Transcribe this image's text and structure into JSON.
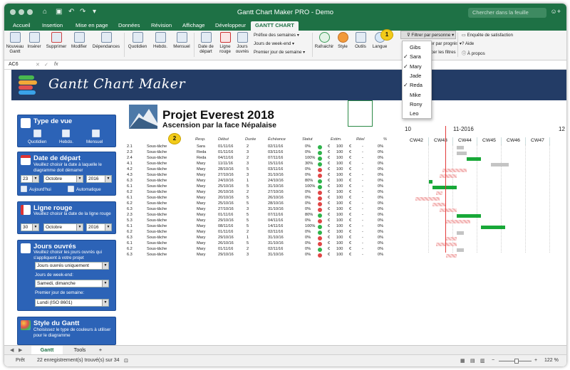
{
  "window": {
    "title": "Gantt Chart Maker PRO - Demo",
    "search_placeholder": "Chercher dans la feuille"
  },
  "menu_tabs": [
    "Accueil",
    "Insertion",
    "Mise en page",
    "Données",
    "Révision",
    "Affichage",
    "Développeur",
    "GANTT CHART"
  ],
  "ribbon": {
    "buttons": [
      {
        "label": "Nouveau\nGantt"
      },
      {
        "label": "Insérer"
      },
      {
        "label": "Supprimer"
      },
      {
        "label": "Modifier"
      },
      {
        "label": "Dépendances"
      },
      {
        "label": "Quotidien"
      },
      {
        "label": "Hebdo."
      },
      {
        "label": "Mensuel"
      },
      {
        "label": "Date de\ndépart"
      },
      {
        "label": "Ligne\nrouge"
      },
      {
        "label": "Jours\nouvrés"
      },
      {
        "label": "Rafraichir"
      },
      {
        "label": "Style"
      },
      {
        "label": "Outils"
      },
      {
        "label": "Langue"
      }
    ],
    "dropdowns": [
      "Préfixe des semaines",
      "Jours de week-end",
      "Premier jour de semaine"
    ],
    "filter_button": "Filtrer par personne",
    "filter_progress": "Filtrer par progrès",
    "clear_filters": "Effacer les filtres",
    "right_links": [
      "Enquête de satisfaction",
      "Aide",
      "À propos"
    ]
  },
  "formula_bar": {
    "cell": "AC6",
    "fx": "fx"
  },
  "banner": {
    "logo_text": "Gantt Chart Maker"
  },
  "left_panels": {
    "view": {
      "title": "Type de vue",
      "options": [
        "Quotidien",
        "Hebdo.",
        "Mensuel"
      ]
    },
    "start": {
      "title": "Date de départ",
      "desc": "Veuillez choisir la date à laquelle le diagramme doit démarrer",
      "day": "23",
      "month": "Octobre",
      "year": "2016",
      "today": "Aujourd'hui",
      "auto": "Automatique"
    },
    "redline": {
      "title": "Ligne rouge",
      "desc": "Veuillez choisir la date de la ligne rouge",
      "day": "30",
      "month": "Octobre",
      "year": "2016"
    },
    "workdays": {
      "title": "Jours ouvrés",
      "desc": "Veuillez choisir les jours ouvrés qui s'appliquent à votre projet",
      "sel1": "Jours ouvrés uniquement",
      "weekend_label": "Jours de week-end:",
      "weekend": "Samedi, dimanche",
      "firstday_label": "Premier jour de semaine:",
      "firstday": "Lundi (ISO 8601)"
    },
    "style": {
      "title": "Style du Gantt",
      "desc": "Choisissez le type de couleurs à utiliser pour le diagramme"
    }
  },
  "project": {
    "title": "Projet Everest 2018",
    "subtitle": "Ascension par la face Népalaise"
  },
  "columns": [
    "Resp.",
    "Début",
    "Durée",
    "Échéance",
    "Statut",
    "Estim.",
    "Réel",
    "%"
  ],
  "gantt_header": {
    "left_num": "10",
    "month": "11-2016",
    "right_num": "12",
    "weeks": [
      "CW42",
      "CW43",
      "CW44",
      "CW45",
      "CW46",
      "CW47"
    ]
  },
  "rows": [
    {
      "id": "2.1",
      "task": "Sous-tâche",
      "resp": "Sara",
      "start": "01/11/16",
      "dur": "2",
      "end": "02/11/16",
      "pct": "0%",
      "status": "green",
      "cur": "€",
      "est": "100",
      "cur2": "€",
      "real": "-",
      "rp": "0%"
    },
    {
      "id": "2.3",
      "task": "Sous-tâche",
      "resp": "Reda",
      "start": "01/11/16",
      "dur": "3",
      "end": "03/11/16",
      "pct": "0%",
      "status": "green",
      "cur": "€",
      "est": "100",
      "cur2": "€",
      "real": "-",
      "rp": "0%"
    },
    {
      "id": "2.4",
      "task": "Sous-tâche",
      "resp": "Reda",
      "start": "04/11/16",
      "dur": "2",
      "end": "07/11/16",
      "pct": "100%",
      "status": "green",
      "cur": "€",
      "est": "100",
      "cur2": "€",
      "real": "-",
      "rp": "0%"
    },
    {
      "id": "4.1",
      "task": "Sous-tâche",
      "resp": "Mary",
      "start": "11/11/16",
      "dur": "3",
      "end": "15/11/16",
      "pct": "30%",
      "status": "green",
      "cur": "€",
      "est": "100",
      "cur2": "€",
      "real": "-",
      "rp": "0%"
    },
    {
      "id": "4.2",
      "task": "Sous-tâche",
      "resp": "Mary",
      "start": "28/10/16",
      "dur": "5",
      "end": "03/11/16",
      "pct": "0%",
      "status": "red",
      "cur": "€",
      "est": "100",
      "cur2": "€",
      "real": "-",
      "rp": "0%"
    },
    {
      "id": "4.3",
      "task": "Sous-tâche",
      "resp": "Mary",
      "start": "27/10/16",
      "dur": "3",
      "end": "31/10/16",
      "pct": "0%",
      "status": "red",
      "cur": "€",
      "est": "100",
      "cur2": "€",
      "real": "-",
      "rp": "0%"
    },
    {
      "id": "6.3",
      "task": "Sous-tâche",
      "resp": "Mary",
      "start": "24/10/16",
      "dur": "1",
      "end": "24/10/16",
      "pct": "80%",
      "status": "green",
      "cur": "€",
      "est": "100",
      "cur2": "€",
      "real": "-",
      "rp": "0%"
    },
    {
      "id": "6.1",
      "task": "Sous-tâche",
      "resp": "Mary",
      "start": "25/10/16",
      "dur": "5",
      "end": "31/10/16",
      "pct": "100%",
      "status": "green",
      "cur": "€",
      "est": "100",
      "cur2": "€",
      "real": "-",
      "rp": "0%"
    },
    {
      "id": "6.2",
      "task": "Sous-tâche",
      "resp": "Mary",
      "start": "26/10/16",
      "dur": "2",
      "end": "27/10/16",
      "pct": "0%",
      "status": "red",
      "cur": "€",
      "est": "100",
      "cur2": "€",
      "real": "-",
      "rp": "0%"
    },
    {
      "id": "6.1",
      "task": "Sous-tâche",
      "resp": "Mary",
      "start": "20/10/16",
      "dur": "5",
      "end": "26/10/16",
      "pct": "0%",
      "status": "red",
      "cur": "€",
      "est": "100",
      "cur2": "€",
      "real": "-",
      "rp": "0%"
    },
    {
      "id": "6.2",
      "task": "Sous-tâche",
      "resp": "Mary",
      "start": "25/10/16",
      "dur": "5",
      "end": "28/10/16",
      "pct": "0%",
      "status": "red",
      "cur": "€",
      "est": "100",
      "cur2": "€",
      "real": "-",
      "rp": "0%"
    },
    {
      "id": "6.3",
      "task": "Sous-tâche",
      "resp": "Mary",
      "start": "27/10/16",
      "dur": "3",
      "end": "31/10/16",
      "pct": "0%",
      "status": "red",
      "cur": "€",
      "est": "100",
      "cur2": "€",
      "real": "-",
      "rp": "0%"
    },
    {
      "id": "2.3",
      "task": "Sous-tâche",
      "resp": "Mary",
      "start": "01/11/16",
      "dur": "5",
      "end": "07/11/16",
      "pct": "80%",
      "status": "green",
      "cur": "€",
      "est": "100",
      "cur2": "€",
      "real": "-",
      "rp": "0%"
    },
    {
      "id": "5.3",
      "task": "Sous-tâche",
      "resp": "Mary",
      "start": "29/10/16",
      "dur": "5",
      "end": "04/11/16",
      "pct": "0%",
      "status": "red",
      "cur": "€",
      "est": "100",
      "cur2": "€",
      "real": "-",
      "rp": "0%"
    },
    {
      "id": "6.1",
      "task": "Sous-tâche",
      "resp": "Mary",
      "start": "08/11/16",
      "dur": "5",
      "end": "14/11/16",
      "pct": "100%",
      "status": "green",
      "cur": "€",
      "est": "100",
      "cur2": "€",
      "real": "-",
      "rp": "0%"
    },
    {
      "id": "6.2",
      "task": "Sous-tâche",
      "resp": "Mary",
      "start": "01/11/16",
      "dur": "2",
      "end": "02/11/16",
      "pct": "0%",
      "status": "green",
      "cur": "€",
      "est": "100",
      "cur2": "€",
      "real": "-",
      "rp": "0%"
    },
    {
      "id": "6.3",
      "task": "Sous-tâche",
      "resp": "Mary",
      "start": "29/10/16",
      "dur": "1",
      "end": "31/10/16",
      "pct": "0%",
      "status": "red",
      "cur": "€",
      "est": "100",
      "cur2": "€",
      "real": "-",
      "rp": "0%"
    },
    {
      "id": "6.1",
      "task": "Sous-tâche",
      "resp": "Mary",
      "start": "26/10/16",
      "dur": "5",
      "end": "31/10/16",
      "pct": "0%",
      "status": "red",
      "cur": "€",
      "est": "100",
      "cur2": "€",
      "real": "-",
      "rp": "0%"
    },
    {
      "id": "6.2",
      "task": "Sous-tâche",
      "resp": "Mary",
      "start": "01/11/16",
      "dur": "2",
      "end": "02/11/16",
      "pct": "0%",
      "status": "green",
      "cur": "€",
      "est": "100",
      "cur2": "€",
      "real": "-",
      "rp": "0%"
    },
    {
      "id": "6.3",
      "task": "Sous-tâche",
      "resp": "Mary",
      "start": "29/10/16",
      "dur": "3",
      "end": "31/10/16",
      "pct": "0%",
      "status": "red",
      "cur": "€",
      "est": "100",
      "cur2": "€",
      "real": "-",
      "rp": "0%"
    }
  ],
  "dropdown_people": [
    {
      "name": "Gibs",
      "checked": false
    },
    {
      "name": "Sara",
      "checked": true
    },
    {
      "name": "Mary",
      "checked": true
    },
    {
      "name": "Jade",
      "checked": false
    },
    {
      "name": "Reda",
      "checked": true
    },
    {
      "name": "Mike",
      "checked": false
    },
    {
      "name": "Rony",
      "checked": false
    },
    {
      "name": "Leo",
      "checked": false
    }
  ],
  "badges": [
    "1",
    "2"
  ],
  "sheet_tabs": [
    "Gantt",
    "Tools",
    "+"
  ],
  "status_bar": {
    "ready": "Prêt",
    "found": "22 enregistrement(s) trouvé(s) sur 34",
    "zoom": "122 %"
  },
  "colors": {
    "excel_green": "#1e7145",
    "banner": "#233c66",
    "panel": "#2c63b7",
    "bar_green": "#18a838",
    "bar_gray": "#c4c4c4",
    "bar_pink": "#f2b3b3",
    "red_line": "#e23b3b"
  }
}
